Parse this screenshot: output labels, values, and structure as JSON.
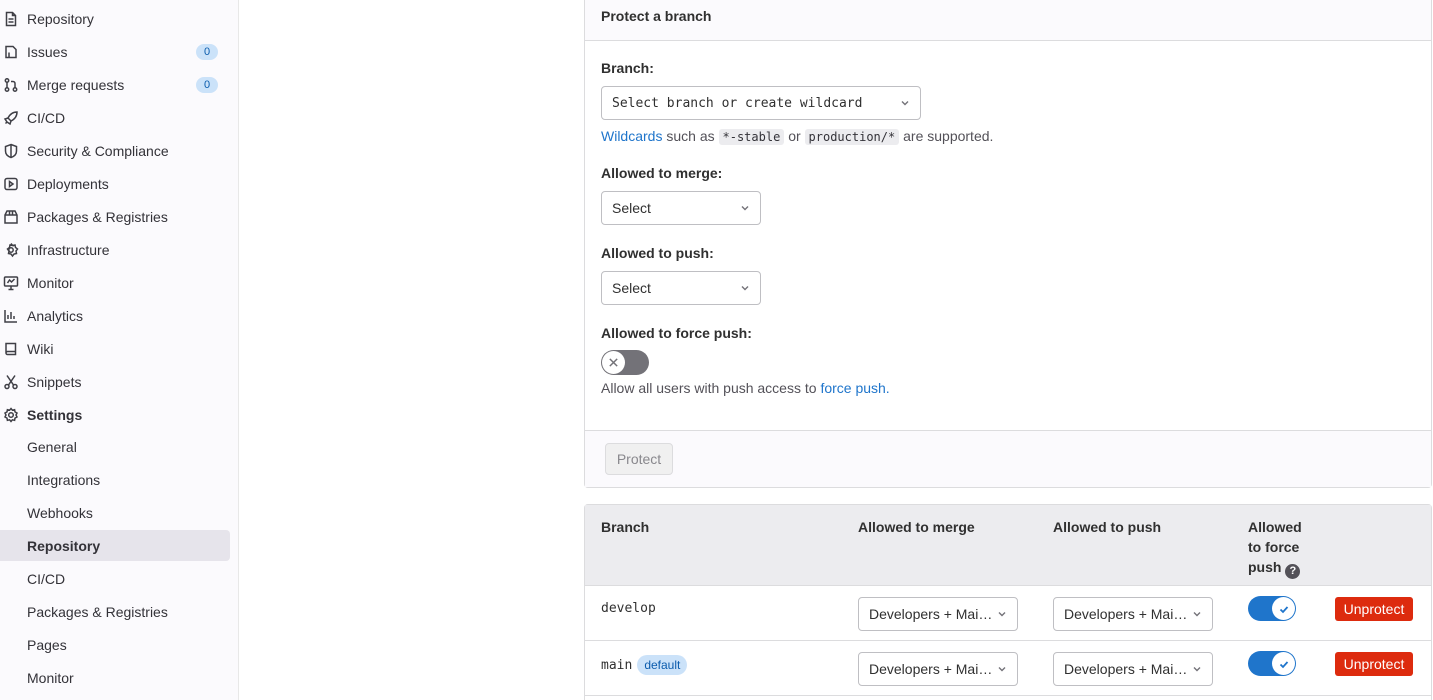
{
  "sidebar": {
    "items": [
      {
        "label": "Repository",
        "icon": "document-icon"
      },
      {
        "label": "Issues",
        "icon": "issues-icon",
        "count": "0"
      },
      {
        "label": "Merge requests",
        "icon": "merge-request-icon",
        "count": "0"
      },
      {
        "label": "CI/CD",
        "icon": "rocket-icon"
      },
      {
        "label": "Security & Compliance",
        "icon": "shield-icon"
      },
      {
        "label": "Deployments",
        "icon": "deployments-icon"
      },
      {
        "label": "Packages & Registries",
        "icon": "package-icon"
      },
      {
        "label": "Infrastructure",
        "icon": "cloud-gear-icon"
      },
      {
        "label": "Monitor",
        "icon": "monitor-icon"
      },
      {
        "label": "Analytics",
        "icon": "chart-icon"
      },
      {
        "label": "Wiki",
        "icon": "book-icon"
      },
      {
        "label": "Snippets",
        "icon": "scissors-icon"
      },
      {
        "label": "Settings",
        "icon": "gear-icon"
      }
    ],
    "settings_items": [
      {
        "label": "General"
      },
      {
        "label": "Integrations"
      },
      {
        "label": "Webhooks"
      },
      {
        "label": "Repository"
      },
      {
        "label": "CI/CD"
      },
      {
        "label": "Packages & Registries"
      },
      {
        "label": "Pages"
      },
      {
        "label": "Monitor"
      }
    ]
  },
  "protect_form": {
    "title": "Protect a branch",
    "branch_label": "Branch:",
    "branch_placeholder": "Select branch or create wildcard",
    "help_wildcards_link": "Wildcards",
    "help_such_as": "such as",
    "help_code1": "*-stable",
    "help_or": "or",
    "help_code2": "production/*",
    "help_supported": "are supported.",
    "merge_label": "Allowed to merge:",
    "merge_value": "Select",
    "push_label": "Allowed to push:",
    "push_value": "Select",
    "force_label": "Allowed to force push:",
    "force_help_text": "Allow all users with push access to",
    "force_help_link": "force push.",
    "protect_button": "Protect"
  },
  "table": {
    "headers": {
      "branch": "Branch",
      "merge": "Allowed to merge",
      "push": "Allowed to push",
      "force_line1": "Allowed",
      "force_line2": "to force",
      "force_line3": "push"
    },
    "rows": [
      {
        "branch": "develop",
        "badge": "",
        "merge": "Developers + Maintainers",
        "push": "Developers + Maintainers",
        "action": "Unprotect"
      },
      {
        "branch": "main",
        "badge": "default",
        "merge": "Developers + Maintainers",
        "push": "Developers + Maintainers",
        "action": "Unprotect"
      }
    ]
  },
  "colors": {
    "accent": "#1f75cb",
    "danger": "#dd2b0e",
    "sidebar_active": "#e6e4eb"
  }
}
